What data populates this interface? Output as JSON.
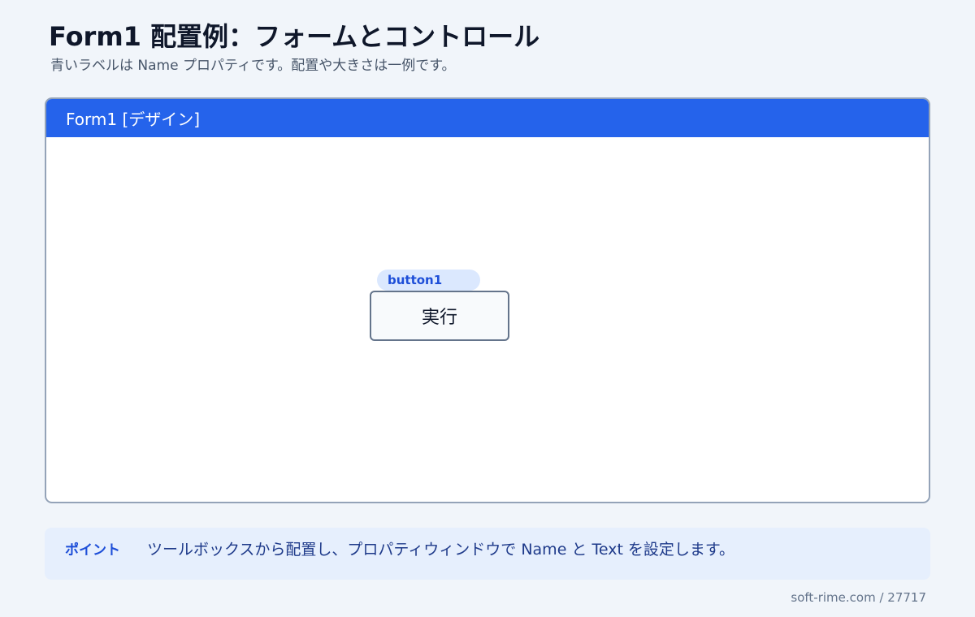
{
  "header": {
    "title": "Form1 配置例：フォームとコントロール",
    "subtitle": "青いラベルは Name プロパティです。配置や大きさは一例です。"
  },
  "form": {
    "title": "Form1 [デザイン]",
    "controls": [
      {
        "name": "button1",
        "text": "実行"
      }
    ]
  },
  "tip": {
    "label": "ポイント",
    "text": "ツールボックスから配置し、プロパティウィンドウで Name と Text を設定します。"
  },
  "footer": {
    "text": "soft-rime.com / 27717"
  },
  "colors": {
    "titlebar": "#2563eb",
    "name_tag_bg": "#dbe8fe",
    "name_tag_text": "#1d4ed8",
    "tip_bg": "#e6effd",
    "page_bg": "#f1f5fa"
  }
}
